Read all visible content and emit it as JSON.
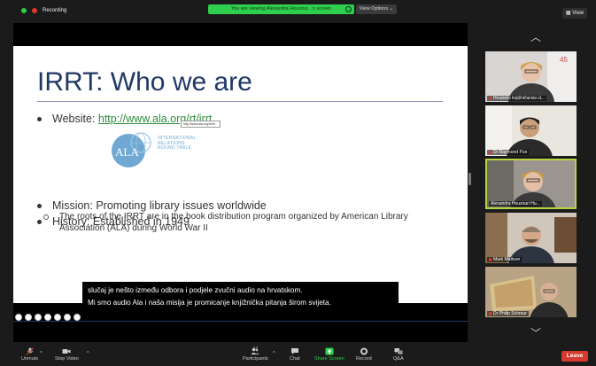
{
  "topbar": {
    "recording_label": "Recording",
    "viewing_banner": "You are viewing Alexandra Houzour...'s screen",
    "view_options": "View Options ⌄",
    "view_button": "View"
  },
  "slide": {
    "title": "IRRT: Who we are",
    "bullets": {
      "website_label": "Website: ",
      "website_link": "http://www.ala.org/rt/irrt",
      "mission": "Mission: Promoting library issues worldwide",
      "history": "History: Established in 1949"
    },
    "sub_bullet": "The roots of the IRRT are in the book distribution program organized by American Library Association (ALA) during World War II",
    "logo_ala": "ALA",
    "logo_text": [
      "INTERNATIONAL",
      "RELATIONS",
      "ROUND TABLE"
    ],
    "tooltip": "http://www.ala.org/rt/irrt"
  },
  "caption": {
    "line1": "slučaj je nešto između odbora i podjele zvučni audio na hrvatskom.",
    "line2": "Mi smo audio Ala i naša misija je promicanje knjižnička pitanja širom svijeta."
  },
  "participants": [
    {
      "name": "Hrvatsko knjižničarsko d..."
    },
    {
      "name": "Dr Raymond Pun"
    },
    {
      "name": "Alexandra Houzouri Hu..."
    },
    {
      "name": "Mark Mattson"
    },
    {
      "name": "Dr Philip Schreur"
    }
  ],
  "toolbar": {
    "unmute": "Unmute",
    "stop_video": "Stop Video",
    "participants": "Participants",
    "participants_count": "13",
    "chat": "Chat",
    "share_screen": "Share Screen",
    "record": "Record",
    "qa": "Q&A",
    "leave": "Leave"
  },
  "colors": {
    "recording_dot": "#2ecc40",
    "banner": "#2fcf4e",
    "slide_title": "#1f3864",
    "link": "#2d8c3c",
    "leave": "#d63a2f",
    "active_speaker": "#b6d641",
    "share_icon": "#2fcf4e"
  }
}
